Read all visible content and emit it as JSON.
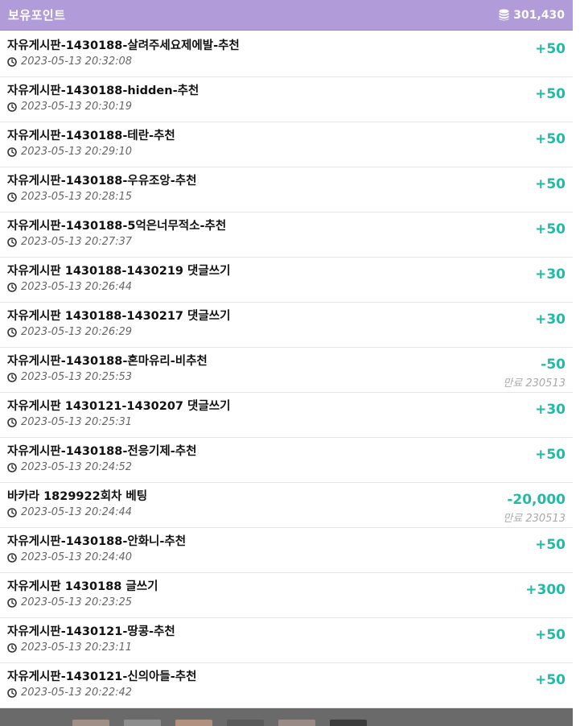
{
  "header": {
    "title": "보유포인트",
    "balance": "301,430"
  },
  "rows": [
    {
      "desc": "자유게시판-1430188-살려주세요제에발-추천",
      "time": "2023-05-13 20:32:08",
      "amount": "+50",
      "expiry": ""
    },
    {
      "desc": "자유게시판-1430188-hidden-추천",
      "time": "2023-05-13 20:30:19",
      "amount": "+50",
      "expiry": ""
    },
    {
      "desc": "자유게시판-1430188-테란-추천",
      "time": "2023-05-13 20:29:10",
      "amount": "+50",
      "expiry": ""
    },
    {
      "desc": "자유게시판-1430188-우유조앙-추천",
      "time": "2023-05-13 20:28:15",
      "amount": "+50",
      "expiry": ""
    },
    {
      "desc": "자유게시판-1430188-5억은너무적소-추천",
      "time": "2023-05-13 20:27:37",
      "amount": "+50",
      "expiry": ""
    },
    {
      "desc": "자유게시판 1430188-1430219 댓글쓰기",
      "time": "2023-05-13 20:26:44",
      "amount": "+30",
      "expiry": ""
    },
    {
      "desc": "자유게시판 1430188-1430217 댓글쓰기",
      "time": "2023-05-13 20:26:29",
      "amount": "+30",
      "expiry": ""
    },
    {
      "desc": "자유게시판-1430188-혼마유리-비추천",
      "time": "2023-05-13 20:25:53",
      "amount": "-50",
      "expiry": "만료 230513"
    },
    {
      "desc": "자유게시판 1430121-1430207 댓글쓰기",
      "time": "2023-05-13 20:25:31",
      "amount": "+30",
      "expiry": ""
    },
    {
      "desc": "자유게시판-1430188-전응기제-추천",
      "time": "2023-05-13 20:24:52",
      "amount": "+50",
      "expiry": ""
    },
    {
      "desc": "바카라 1829922회차 베팅",
      "time": "2023-05-13 20:24:44",
      "amount": "-20,000",
      "expiry": "만료 230513"
    },
    {
      "desc": "자유게시판-1430188-안화니-추천",
      "time": "2023-05-13 20:24:40",
      "amount": "+50",
      "expiry": ""
    },
    {
      "desc": "자유게시판 1430188 글쓰기",
      "time": "2023-05-13 20:23:25",
      "amount": "+300",
      "expiry": ""
    },
    {
      "desc": "자유게시판-1430121-땅콩-추천",
      "time": "2023-05-13 20:23:11",
      "amount": "+50",
      "expiry": ""
    },
    {
      "desc": "자유게시판-1430121-신의아들-추천",
      "time": "2023-05-13 20:22:42",
      "amount": "+50",
      "expiry": ""
    }
  ],
  "icons": {
    "balance": "coins-stack-icon",
    "time": "clock-icon"
  },
  "colors": {
    "header_bg": "#b19cd9",
    "amount": "#1fbba6",
    "expiry": "#aaaaaa"
  }
}
